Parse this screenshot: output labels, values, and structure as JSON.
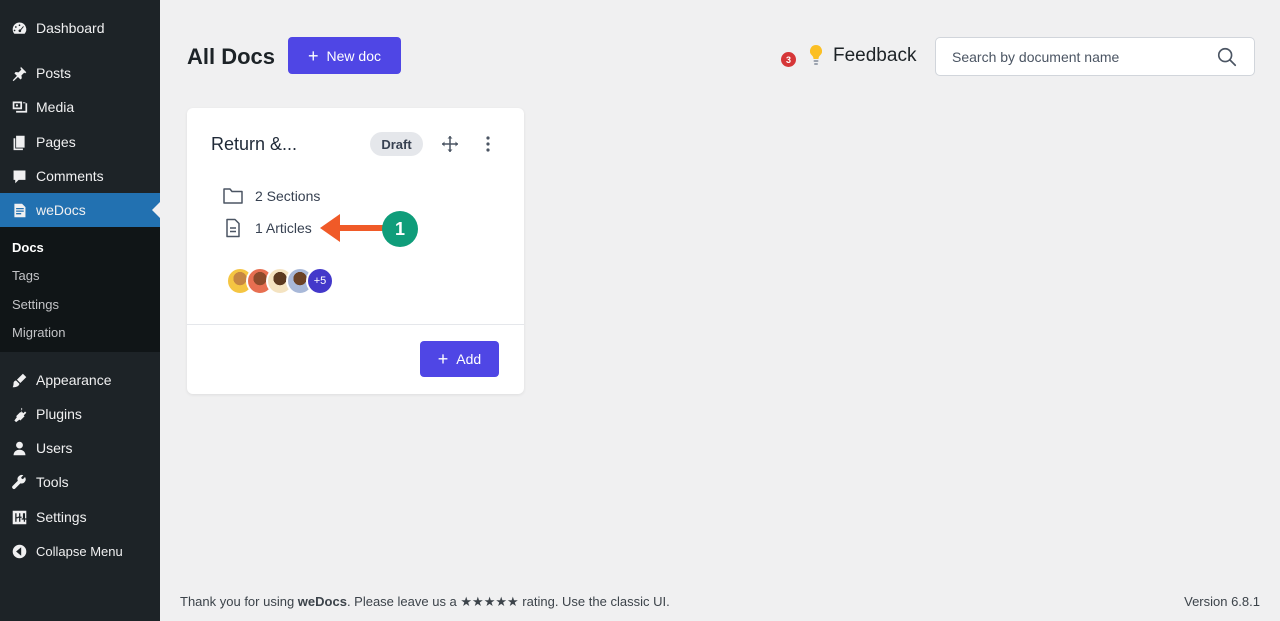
{
  "sidebar": {
    "items": [
      {
        "label": "Dashboard",
        "icon": "dashboard-icon"
      },
      {
        "label": "Posts",
        "icon": "pin-icon"
      },
      {
        "label": "Media",
        "icon": "media-icon"
      },
      {
        "label": "Pages",
        "icon": "pages-icon"
      },
      {
        "label": "Comments",
        "icon": "comment-icon"
      },
      {
        "label": "weDocs",
        "icon": "document-icon",
        "active": true
      },
      {
        "label": "Appearance",
        "icon": "brush-icon"
      },
      {
        "label": "Plugins",
        "icon": "plugin-icon"
      },
      {
        "label": "Users",
        "icon": "user-icon"
      },
      {
        "label": "Tools",
        "icon": "wrench-icon"
      },
      {
        "label": "Settings",
        "icon": "sliders-icon"
      },
      {
        "label": "Collapse Menu",
        "icon": "collapse-icon"
      }
    ],
    "submenu": [
      {
        "label": "Docs",
        "current": true
      },
      {
        "label": "Tags"
      },
      {
        "label": "Settings"
      },
      {
        "label": "Migration"
      }
    ]
  },
  "header": {
    "title": "All Docs",
    "new_doc_label": "New doc",
    "notification_count": "3",
    "feedback_label": "Feedback",
    "search_placeholder": "Search by document name"
  },
  "card": {
    "title": "Return &...",
    "status": "Draft",
    "sections": "2 Sections",
    "articles": "1 Articles",
    "contributors_more": "+5",
    "add_label": "Add"
  },
  "annotation": {
    "step_number": "1",
    "color": "#0f9d7a",
    "arrow_color": "#f05a28"
  },
  "footer": {
    "prefix": "Thank you for using ",
    "brand": "weDocs",
    "middle": ". Please leave us a ",
    "stars": "★★★★★",
    "rating_text": " rating. ",
    "classic_link": "Use the classic UI.",
    "version": "Version 6.8.1"
  },
  "colors": {
    "sidebar_bg": "#1d2327",
    "active_menu": "#2271b1",
    "primary_button": "#4f46e5",
    "notification_badge": "#d63638"
  }
}
